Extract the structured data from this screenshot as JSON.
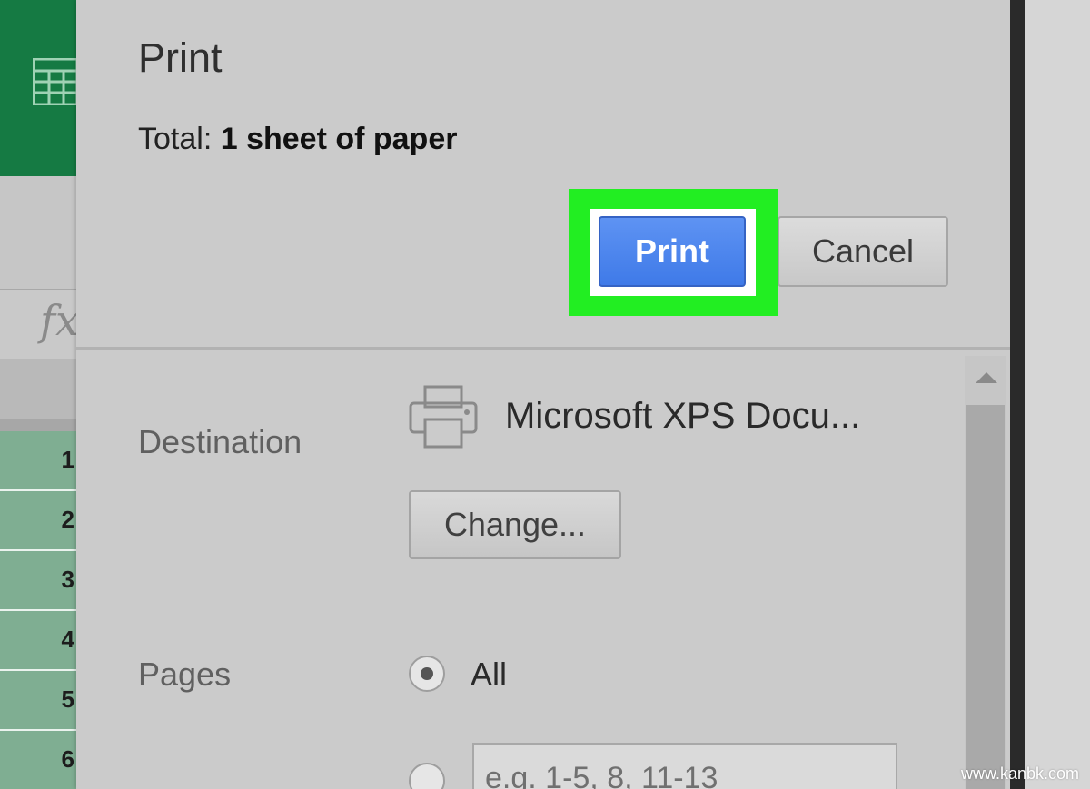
{
  "excel": {
    "formula_label": "fx",
    "row_numbers": [
      "1",
      "2",
      "3",
      "4",
      "5",
      "6"
    ]
  },
  "dialog": {
    "title": "Print",
    "total_prefix": "Total: ",
    "total_value": "1 sheet of paper",
    "print_button": "Print",
    "cancel_button": "Cancel",
    "destination_label": "Destination",
    "destination_name": "Microsoft XPS Docu...",
    "change_button": "Change...",
    "pages_label": "Pages",
    "pages_all_label": "All",
    "pages_all_selected": true,
    "pages_input_placeholder": "e.g. 1-5, 8, 11-13"
  },
  "colors": {
    "excel_green": "#157a43",
    "print_button_blue": "#4a84ee",
    "highlight_green": "#22ee22"
  },
  "watermark": "www.kanbk.com"
}
